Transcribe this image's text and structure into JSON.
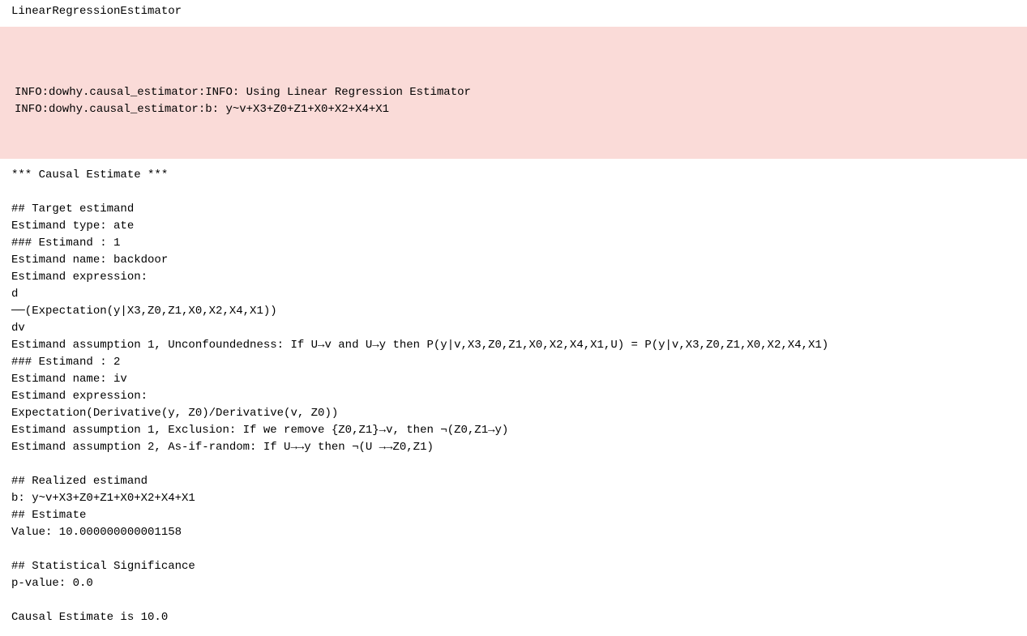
{
  "title": "LinearRegressionEstimator",
  "info": {
    "line1": "INFO:dowhy.causal_estimator:INFO: Using Linear Regression Estimator",
    "line2": "INFO:dowhy.causal_estimator:b: y~v+X3+Z0+Z1+X0+X2+X4+X1"
  },
  "output": {
    "header": "*** Causal Estimate ***",
    "target_header": "## Target estimand",
    "estimand_type": "Estimand type: ate",
    "est1_header": "### Estimand : 1",
    "est1_name": "Estimand name: backdoor",
    "est1_expr_label": "Estimand expression:",
    "est1_expr_top": "d",
    "est1_expr_mid": "──(Expectation(y|X3,Z0,Z1,X0,X2,X4,X1))",
    "est1_expr_bot": "dv",
    "est1_assume": "Estimand assumption 1, Unconfoundedness: If U→v and U→y then P(y|v,X3,Z0,Z1,X0,X2,X4,X1,U) = P(y|v,X3,Z0,Z1,X0,X2,X4,X1)",
    "est2_header": "### Estimand : 2",
    "est2_name": "Estimand name: iv",
    "est2_expr_label": "Estimand expression:",
    "est2_expr": "Expectation(Derivative(y, Z0)/Derivative(v, Z0))",
    "est2_assume1": "Estimand assumption 1, Exclusion: If we remove {Z0,Z1}→v, then ¬(Z0,Z1→y)",
    "est2_assume2": "Estimand assumption 2, As-if-random: If U→→y then ¬(U →→Z0,Z1)",
    "realized_header": "## Realized estimand",
    "realized_expr": "b: y~v+X3+Z0+Z1+X0+X2+X4+X1",
    "estimate_header": "## Estimate",
    "estimate_value": "Value: 10.000000000001158",
    "sig_header": "## Statistical Significance",
    "pvalue": "p-value: 0.0",
    "final": "Causal Estimate is 10.0"
  }
}
